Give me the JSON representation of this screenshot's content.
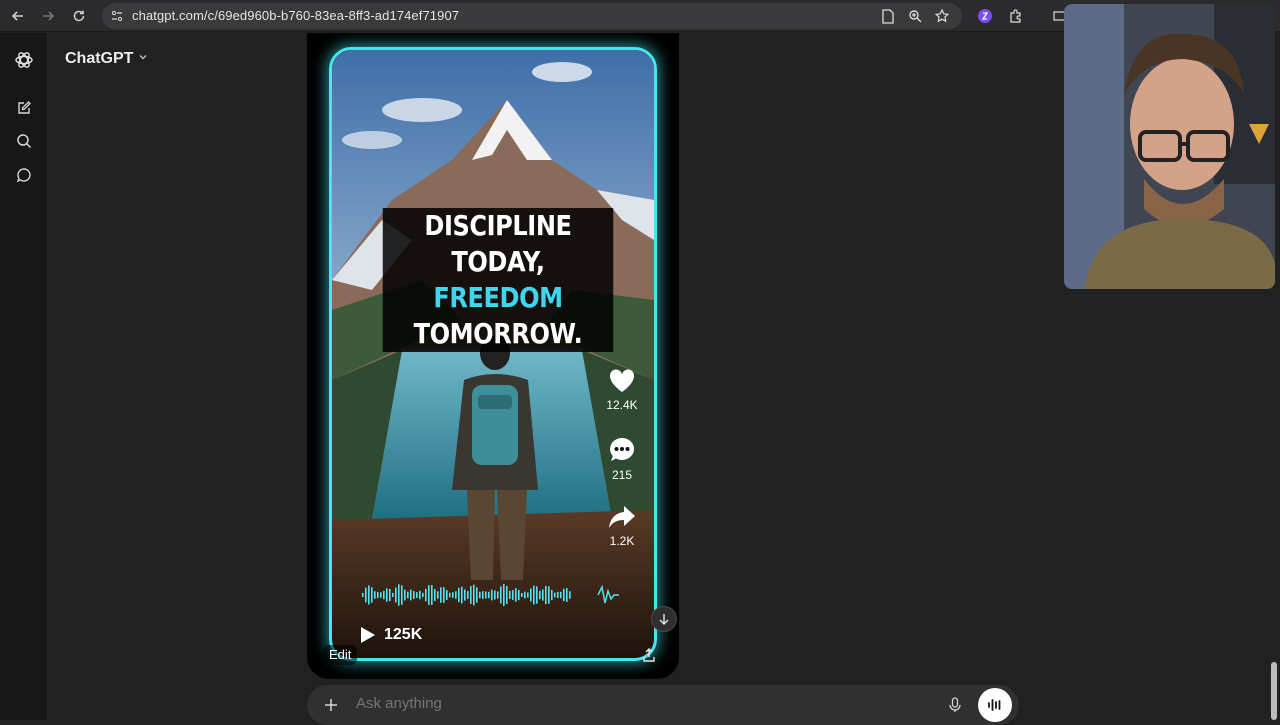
{
  "browser": {
    "url": "chatgpt.com/c/69ed960b-b760-83ea-8ff3-ad174ef71907",
    "icons": [
      "back-icon",
      "forward-icon",
      "reload-icon",
      "site-info-icon",
      "page-icon",
      "zoom-icon",
      "bookmark-star-icon",
      "extension-avatar-icon",
      "extensions-puzzle-icon",
      "cast-icon"
    ]
  },
  "app": {
    "model_name": "ChatGPT",
    "sidebar_icons": [
      "openai-logo-icon",
      "new-chat-icon",
      "search-icon",
      "chat-bubble-icon"
    ]
  },
  "video": {
    "headline_line1": "DISCIPLINE TODAY,",
    "headline_accent": "FREEDOM",
    "headline_rest": " TOMORROW.",
    "likes": "12.4K",
    "comments": "215",
    "shares": "1.2K",
    "views": "125K",
    "accent_color": "#45e6ef"
  },
  "card_actions": {
    "edit_label": "Edit"
  },
  "composer": {
    "placeholder": "Ask anything"
  }
}
